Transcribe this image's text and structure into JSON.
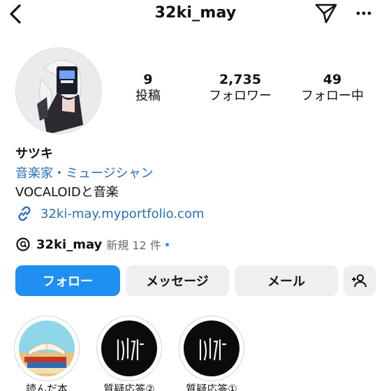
{
  "header": {
    "username": "32ki_may"
  },
  "stats": [
    {
      "value": "9",
      "label": "投稿"
    },
    {
      "value": "2,735",
      "label": "フォロワー"
    },
    {
      "value": "49",
      "label": "フォロー中"
    }
  ],
  "profile": {
    "display_name": "サツキ",
    "category": "音楽家・ミュージシャン",
    "bio": "VOCALOIDと音楽",
    "link": "32ki-may.myportfolio.com"
  },
  "threads": {
    "handle": "32ki_may",
    "new_label": "新規 12 件"
  },
  "buttons": {
    "follow": "フォロー",
    "message": "メッセージ",
    "email": "メール"
  },
  "highlights": [
    {
      "label": "読んだ本"
    },
    {
      "label": "質疑応答②"
    },
    {
      "label": "質疑応答①"
    }
  ],
  "colors": {
    "accent": "#1f8ff2",
    "link": "#2a6fb7",
    "button_bg": "#efefef"
  }
}
